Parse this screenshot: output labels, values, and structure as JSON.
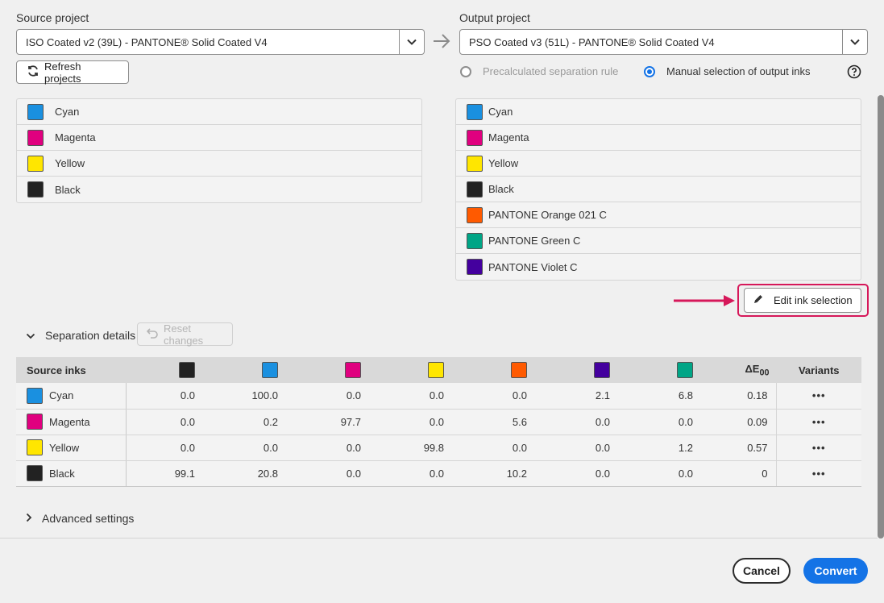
{
  "source": {
    "label": "Source project",
    "selected": "ISO Coated v2 (39L) - PANTONE® Solid Coated V4",
    "refresh_label": "Refresh projects",
    "inks": [
      {
        "name": "Cyan",
        "color": "#1a90e0"
      },
      {
        "name": "Magenta",
        "color": "#e0007f"
      },
      {
        "name": "Yellow",
        "color": "#ffe600"
      },
      {
        "name": "Black",
        "color": "#222222"
      }
    ]
  },
  "output": {
    "label": "Output project",
    "selected": "PSO Coated v3 (51L) - PANTONE® Solid Coated V4",
    "radio_precalc": "Precalculated separation rule",
    "radio_manual": "Manual selection of output inks",
    "inks": [
      {
        "name": "Cyan",
        "color": "#1a90e0"
      },
      {
        "name": "Magenta",
        "color": "#e0007f"
      },
      {
        "name": "Yellow",
        "color": "#ffe600"
      },
      {
        "name": "Black",
        "color": "#222222"
      },
      {
        "name": "PANTONE Orange 021 C",
        "color": "#ff5a00"
      },
      {
        "name": "PANTONE Green C",
        "color": "#00a586"
      },
      {
        "name": "PANTONE Violet C",
        "color": "#44009e"
      }
    ],
    "edit_label": "Edit ink selection"
  },
  "separation": {
    "label": "Separation details",
    "reset_label": "Reset changes",
    "header_source": "Source inks",
    "header_delta": "ΔE00",
    "header_variants": "Variants",
    "column_colors": [
      "#222222",
      "#1a90e0",
      "#e0007f",
      "#ffe600",
      "#ff5a00",
      "#44009e",
      "#00a586"
    ],
    "rows": [
      {
        "ink": "Cyan",
        "color": "#1a90e0",
        "values": [
          "0.0",
          "100.0",
          "0.0",
          "0.0",
          "0.0",
          "2.1",
          "6.8"
        ],
        "delta": "0.18"
      },
      {
        "ink": "Magenta",
        "color": "#e0007f",
        "values": [
          "0.0",
          "0.2",
          "97.7",
          "0.0",
          "5.6",
          "0.0",
          "0.0"
        ],
        "delta": "0.09"
      },
      {
        "ink": "Yellow",
        "color": "#ffe600",
        "values": [
          "0.0",
          "0.0",
          "0.0",
          "99.8",
          "0.0",
          "0.0",
          "1.2"
        ],
        "delta": "0.57"
      },
      {
        "ink": "Black",
        "color": "#222222",
        "values": [
          "99.1",
          "20.8",
          "0.0",
          "0.0",
          "10.2",
          "0.0",
          "0.0"
        ],
        "delta": "0"
      }
    ],
    "variants_label": "•••"
  },
  "advanced": {
    "label": "Advanced settings"
  },
  "footer": {
    "cancel": "Cancel",
    "convert": "Convert"
  },
  "accent_color": "#1473e6",
  "highlight_color": "#d6185a"
}
